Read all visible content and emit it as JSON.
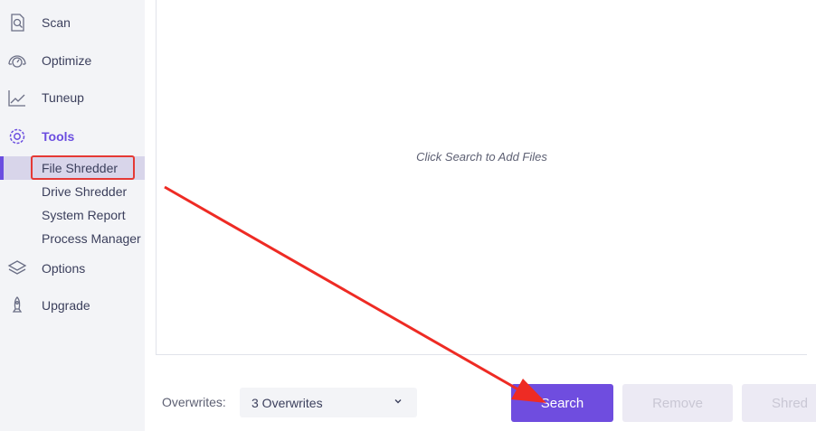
{
  "sidebar": {
    "items": [
      {
        "label": "Scan",
        "icon": "scan-icon"
      },
      {
        "label": "Optimize",
        "icon": "speedometer-icon"
      },
      {
        "label": "Tuneup",
        "icon": "line-chart-icon"
      },
      {
        "label": "Tools",
        "icon": "gear-icon"
      },
      {
        "label": "Options",
        "icon": "layers-icon"
      },
      {
        "label": "Upgrade",
        "icon": "rocket-icon"
      }
    ],
    "tools_subitems": [
      {
        "label": "File Shredder"
      },
      {
        "label": "Drive Shredder"
      },
      {
        "label": "System Report"
      },
      {
        "label": "Process Manager"
      }
    ]
  },
  "main": {
    "drop_hint": "Click Search to Add Files"
  },
  "footer": {
    "overwrites_label": "Overwrites:",
    "overwrites_value": "3 Overwrites",
    "search_label": "Search",
    "remove_label": "Remove",
    "shred_label": "Shred"
  },
  "colors": {
    "accent": "#6f4ddf",
    "annotation": "#e53935",
    "sidebar_bg": "#f3f4f7"
  }
}
